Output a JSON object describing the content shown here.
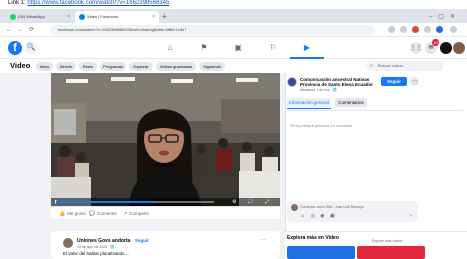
{
  "doc_caption": {
    "prefix": "Link 1:",
    "url": "https://www.facebook.com/watch/?v=1662398566345"
  },
  "browser": {
    "tabs": [
      {
        "label": "(26) WhatsApp",
        "fav_color": "#25d366"
      },
      {
        "label": "Video | Facebook",
        "fav_color": "#1877f2"
      }
    ],
    "new_tab": "+",
    "url": "facebook.com/watch/?v=1662398566345&ref=sharing&rdid=4f8b21c3e7",
    "nav": {
      "back": "←",
      "forward": "→",
      "reload": "⟳"
    }
  },
  "fb": {
    "logo": "f",
    "search_icon": "🔍",
    "nav": [
      {
        "name": "home-icon",
        "glyph": "⌂"
      },
      {
        "name": "flag-icon",
        "glyph": "⚑"
      },
      {
        "name": "marketplace-icon",
        "glyph": "▣"
      },
      {
        "name": "groups-icon",
        "glyph": "⚐"
      },
      {
        "name": "watch-icon",
        "glyph": "▶"
      }
    ],
    "notification_count": "10",
    "menu_icon": "⋮⋮",
    "messenger_icon": "✉"
  },
  "video_header": {
    "title": "Video",
    "chips": [
      "Inicio",
      "Directo",
      "Reels",
      "Programas",
      "Explorar",
      "Videos guardados",
      "Siguiendo"
    ],
    "search_placeholder": "Buscar videos"
  },
  "player": {
    "progress": 0.62,
    "controls": {
      "play": "▶",
      "volume": "🔊",
      "settings": "⚙",
      "fullscreen": "⤢"
    }
  },
  "actions": {
    "like": "Me gusta",
    "comment": "Comentar",
    "share": "Compartir"
  },
  "post": {
    "author": "Uniones Govs andorta",
    "follow": "Seguir",
    "date": "23 de ago. de 2020 · 🌐",
    "more": "···",
    "text": "El valor del hablar pluralizando…"
  },
  "right_panel": {
    "page_name": "Comunicación ancestral Nativas Provincia de Santo Elena Ecuador",
    "page_sub": "Streamed 1 de ene · 🌐",
    "follow_label": "Seguir",
    "more": "···",
    "tab_info": "Información general",
    "tab_comments": "Comentarios",
    "first_comment": "Sé la primera persona en comentar",
    "comment_placeholder": "Comentar como SML. José Luis Ramayo",
    "comment_icons": "☺ ◎ ◉ ▣",
    "send_icon": "➤",
    "explore_title": "Explora más en Video",
    "explore_sub": "Explore más videos"
  }
}
